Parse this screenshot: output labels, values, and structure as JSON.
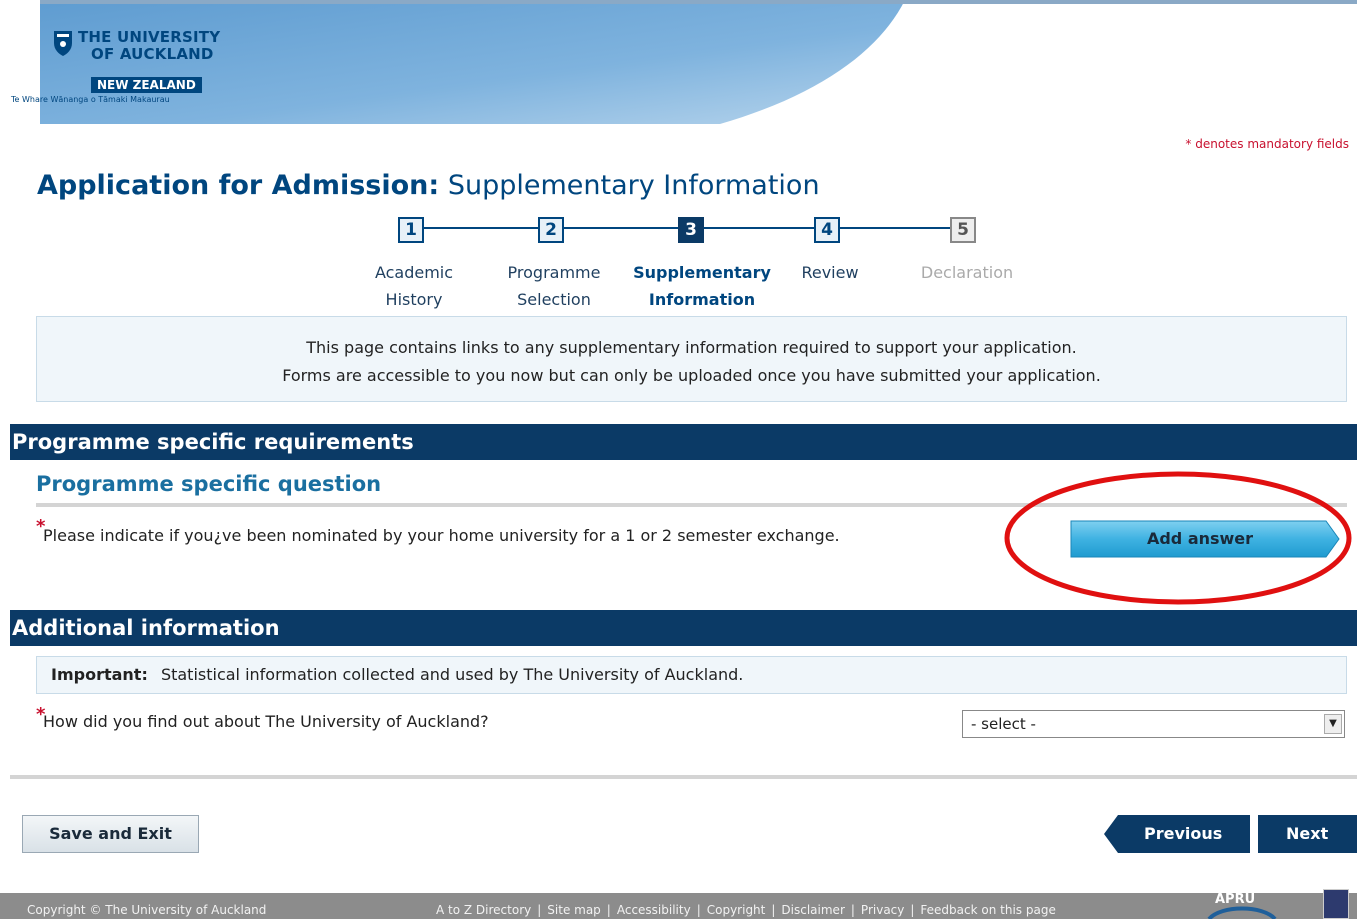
{
  "header": {
    "logo_line1": "THE UNIVERSITY",
    "logo_line2": "OF AUCKLAND",
    "logo_country": "NEW ZEALAND",
    "logo_maori": "Te Whare Wānanga o Tāmaki Makaurau"
  },
  "mandatory_note": "* denotes mandatory fields",
  "title": {
    "bold": "Application for Admission:",
    "rest": "Supplementary Information"
  },
  "steps": [
    {
      "num": "1",
      "line1": "Academic",
      "line2": "History",
      "state": "done"
    },
    {
      "num": "2",
      "line1": "Programme",
      "line2": "Selection",
      "state": "done"
    },
    {
      "num": "3",
      "line1": "Supplementary",
      "line2": "Information",
      "state": "active"
    },
    {
      "num": "4",
      "line1": "Review",
      "line2": "",
      "state": "done"
    },
    {
      "num": "5",
      "line1": "Declaration",
      "line2": "",
      "state": "disabled"
    }
  ],
  "info": {
    "line1": "This page contains links to any supplementary information required to support your application.",
    "line2": "Forms are accessible to you now but can only be uploaded once you have submitted your application."
  },
  "programme_section": {
    "title": "Programme specific requirements",
    "subtitle": "Programme specific question",
    "question": "Please indicate if you¿ve been nominated by your home university for a 1 or 2 semester exchange.",
    "button": "Add answer"
  },
  "additional_section": {
    "title": "Additional information",
    "important_label": "Important:",
    "important_text": "Statistical information collected and used by The University of Auckland.",
    "question": "How did you find out about The University of Auckland?",
    "select_value": "- select -"
  },
  "actions": {
    "save": "Save and Exit",
    "previous": "Previous",
    "next": "Next"
  },
  "footer": {
    "copyright": "Copyright © The University of Auckland",
    "links": [
      "A to Z Directory",
      "Site map",
      "Accessibility",
      "Copyright",
      "Disclaimer",
      "Privacy",
      "Feedback on this page"
    ],
    "apru": "APRU"
  },
  "colors": {
    "brand_blue": "#00467f",
    "section_bar": "#0b3a66",
    "required_red": "#c8102e",
    "button_cyan": "#2aa6d8"
  }
}
